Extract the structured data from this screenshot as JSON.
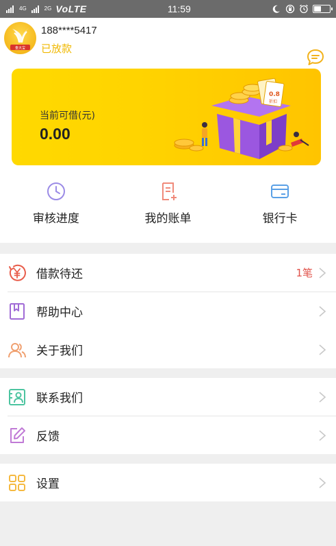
{
  "status_bar": {
    "signal_labels": [
      "4G",
      "2G"
    ],
    "network": "VoLTE",
    "time": "11:59"
  },
  "profile": {
    "phone": "188****5417",
    "status": "已放款",
    "avatar_caption": "金大宝",
    "message_icon": "chat-bubble-icon"
  },
  "banner": {
    "label": "当前可借(元)",
    "amount": "0.00",
    "coupon_text": "0.8",
    "coupon_sub": "折扣"
  },
  "quick_actions": [
    {
      "label": "审核进度",
      "icon": "clock-icon",
      "color": "#9b8be6"
    },
    {
      "label": "我的账单",
      "icon": "bill-icon",
      "color": "#f08a7a"
    },
    {
      "label": "银行卡",
      "icon": "card-icon",
      "color": "#5aa0e6"
    }
  ],
  "menu_group_1": [
    {
      "label": "借款待还",
      "badge": "1笔",
      "icon": "yen-circle-icon",
      "color": "#e85c4a"
    },
    {
      "label": "帮助中心",
      "icon": "bookmark-icon",
      "color": "#a06ad6"
    },
    {
      "label": "关于我们",
      "icon": "people-icon",
      "color": "#f0a070"
    }
  ],
  "menu_group_2": [
    {
      "label": "联系我们",
      "icon": "contact-icon",
      "color": "#4cc4a0"
    },
    {
      "label": "反馈",
      "icon": "edit-icon",
      "color": "#c07ad6"
    }
  ],
  "menu_group_3": [
    {
      "label": "设置",
      "icon": "grid-icon",
      "color": "#f5b940"
    }
  ]
}
